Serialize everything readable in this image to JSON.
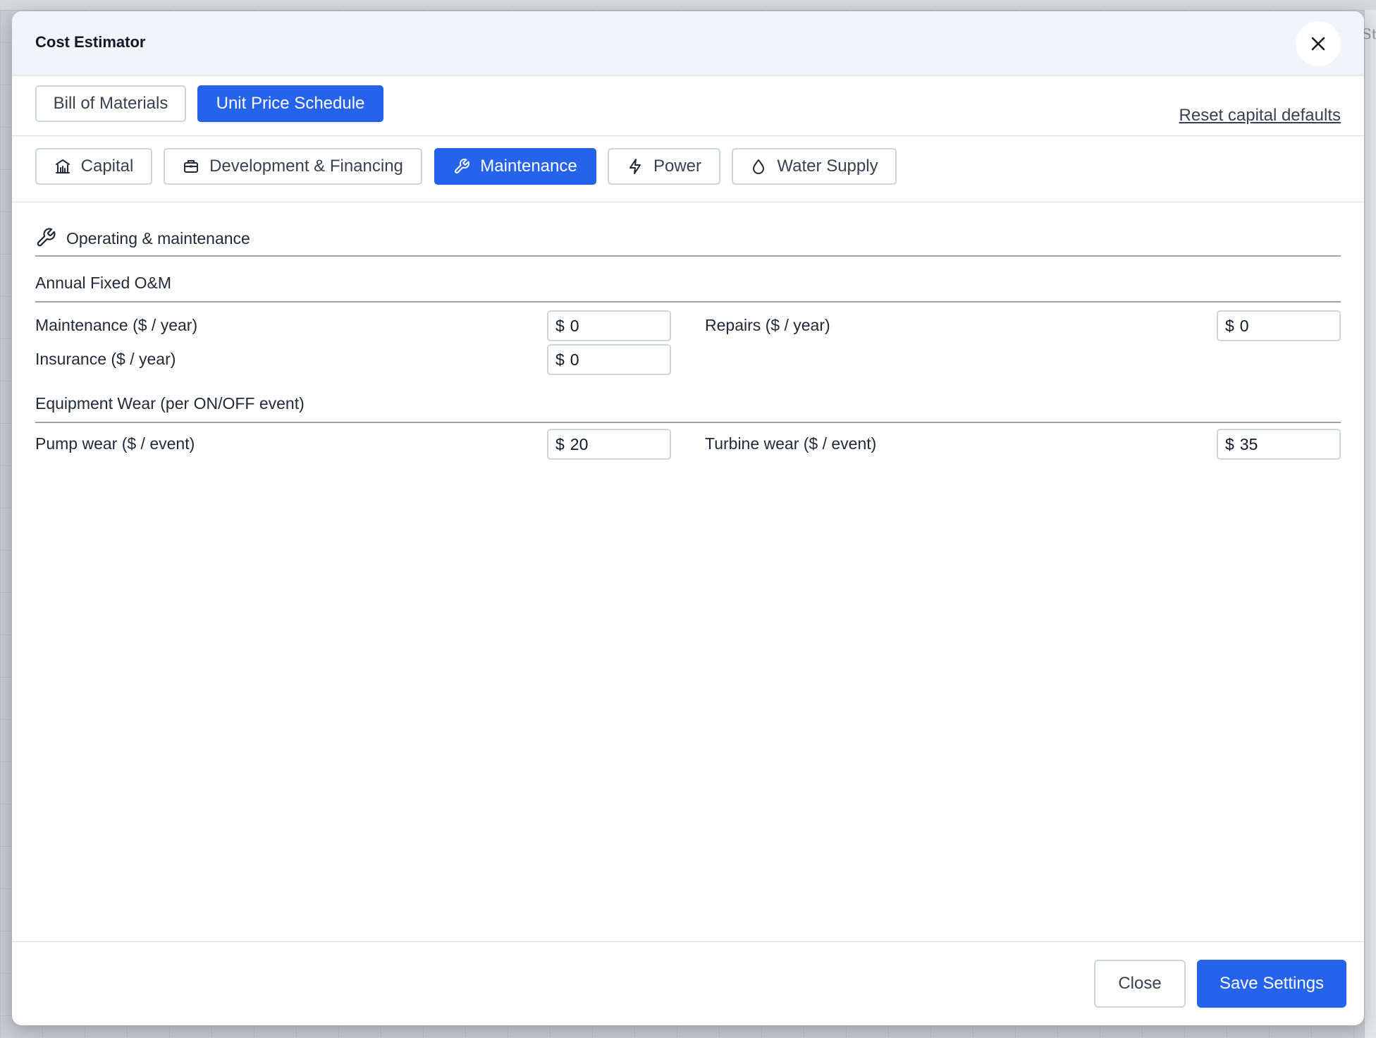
{
  "background": {
    "peek_text": "St"
  },
  "dialog": {
    "title": "Cost Estimator",
    "close_icon": "close-icon"
  },
  "view_tabs": {
    "items": [
      {
        "label": "Bill of Materials",
        "active": false
      },
      {
        "label": "Unit Price Schedule",
        "active": true
      }
    ],
    "reset_link": "Reset capital defaults"
  },
  "category_tabs": [
    {
      "label": "Capital",
      "icon": "bank-icon",
      "active": false
    },
    {
      "label": "Development & Financing",
      "icon": "briefcase-icon",
      "active": false
    },
    {
      "label": "Maintenance",
      "icon": "wrench-icon",
      "active": true
    },
    {
      "label": "Power",
      "icon": "lightning-icon",
      "active": false
    },
    {
      "label": "Water Supply",
      "icon": "water-drop-icon",
      "active": false
    }
  ],
  "section": {
    "title": "Operating & maintenance",
    "icon": "wrench-icon"
  },
  "annual_fixed": {
    "title": "Annual Fixed O&M",
    "fields": [
      {
        "label": "Maintenance ($ / year)",
        "currency": "$",
        "value": "0"
      },
      {
        "label": "Repairs ($ / year)",
        "currency": "$",
        "value": "0"
      },
      {
        "label": "Insurance ($ / year)",
        "currency": "$",
        "value": "0"
      }
    ]
  },
  "equipment_wear": {
    "title": "Equipment Wear (per ON/OFF event)",
    "fields": [
      {
        "label": "Pump wear ($ / event)",
        "currency": "$",
        "value": "20"
      },
      {
        "label": "Turbine wear ($ / event)",
        "currency": "$",
        "value": "35"
      }
    ]
  },
  "footer": {
    "close_label": "Close",
    "save_label": "Save Settings"
  },
  "colors": {
    "accent": "#2563eb",
    "header_bg": "#f1f4f9",
    "border": "#d1d5db"
  }
}
